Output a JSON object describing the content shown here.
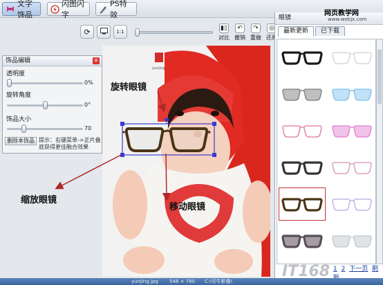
{
  "app": {
    "tabs": [
      {
        "label": "文字饰品",
        "icon": "ribbon-icon"
      },
      {
        "label": "闪图闪字",
        "icon": "flash-icon"
      },
      {
        "label": "PS特效",
        "icon": "brush-icon"
      }
    ]
  },
  "toolbar": {
    "buttons": [
      {
        "label": "对比",
        "icon": "compare-icon"
      },
      {
        "label": "撤销",
        "icon": "undo-icon"
      },
      {
        "label": "重做",
        "icon": "redo-icon"
      },
      {
        "label": "还原",
        "icon": "restore-icon"
      }
    ]
  },
  "edit_panel": {
    "title": "饰品编辑",
    "opacity_label": "透明度",
    "opacity_value": "0%",
    "opacity_level": 0.0,
    "rotate_label": "旋转角度",
    "rotate_value": "0°",
    "rotate_level": 0.5,
    "size_label": "饰品大小",
    "size_value": "70",
    "size_level": 0.2,
    "delete_button": "删除本饰品",
    "hint": "提示：右键菜单->正片叠底获得更佳融合效果"
  },
  "photo": {
    "logo_text": "yunjing"
  },
  "annotations": {
    "rotate": "旋转眼镜",
    "scale": "缩放眼镜",
    "move": "移动眼镜"
  },
  "sidebar": {
    "title": "眼镜",
    "tabs": [
      "最新更新",
      "已下载"
    ],
    "active_tab": 0,
    "selected_index": 8,
    "items": [
      {
        "style": "black-thick",
        "color": "#1a1a1a"
      },
      {
        "style": "rimless-clear",
        "color": "#d9d9d9"
      },
      {
        "style": "grey-sunglasses",
        "color": "#8a8a8a"
      },
      {
        "style": "blue-tinted",
        "color": "#8fc8ee"
      },
      {
        "style": "pink-dotted-cat",
        "color": "#e48ab0"
      },
      {
        "style": "pink-tinted",
        "color": "#e58fd8"
      },
      {
        "style": "black-round",
        "color": "#333333"
      },
      {
        "style": "pink-frame",
        "color": "#d9a6c0"
      },
      {
        "style": "brown-thick",
        "color": "#4a3416"
      },
      {
        "style": "lavender-cat",
        "color": "#c9b4ee"
      },
      {
        "style": "dark-aviator",
        "color": "#5a4f58"
      },
      {
        "style": "clear-wrap",
        "color": "#c9cdd2"
      }
    ],
    "pager": {
      "pages": [
        "1",
        "2"
      ],
      "next": "下一页",
      "refresh": "刷新"
    }
  },
  "watermark": {
    "site_cn": "网页教学网",
    "site_url": "www.webjx.com",
    "logo": "IT168"
  },
  "status": {
    "filename": "yunjing.jpg",
    "dimensions": "548 × 780",
    "path": "C:\\可牛影像\\"
  }
}
